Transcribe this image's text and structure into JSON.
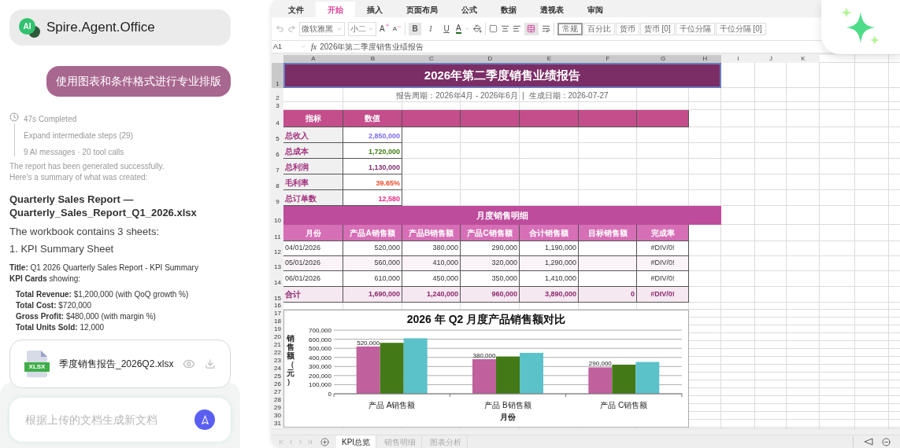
{
  "app": {
    "logo": "AI",
    "title": "Spire.Agent.Office"
  },
  "user_message": "使用图表和条件格式进行专业排版",
  "run": {
    "status": "47s Completed",
    "expand": "Expand intermediate steps (29)",
    "stats": "9 AI messages · 20 tool calls"
  },
  "response": {
    "intro": [
      "The report has been generated successfully.",
      "Here's a summary of what was created:"
    ],
    "heading": "Quarterly Sales Report — Quarterly_Sales_Report_Q1_2026.xlsx",
    "blocks": [
      {
        "kind": "lead",
        "text": "The workbook contains 3 sheets:"
      },
      {
        "kind": "lead",
        "text": "1. KPI Summary Sheet"
      },
      {
        "kind": "detail",
        "text": "**Title:** Q1 2026 Quarterly Sales Report - KPI Summary"
      },
      {
        "kind": "detail",
        "text": "**KPI Cards** showing:"
      },
      {
        "kind": "bullet",
        "text": "**Total Revenue:** $1,200,000 (with QoQ growth %)"
      },
      {
        "kind": "bullet",
        "text": "**Total Cost:** $720,000"
      },
      {
        "kind": "bullet",
        "text": "**Gross Profit:** $480,000 (with margin %)"
      },
      {
        "kind": "bullet",
        "text": "**Total Units Sold:** 12,000"
      }
    ]
  },
  "attachment": {
    "type": "XLSX",
    "name": "季度销售报告_2026Q2.xlsx"
  },
  "composer": {
    "placeholder": "根据上传的文档生成新文档"
  },
  "spreadsheet": {
    "ribbon_tabs": [
      {
        "label": "文件",
        "selected": false
      },
      {
        "label": "开始",
        "selected": true
      },
      {
        "label": "插入",
        "selected": false
      },
      {
        "label": "页面布局",
        "selected": false
      },
      {
        "label": "公式",
        "selected": false
      },
      {
        "label": "数据",
        "selected": false
      },
      {
        "label": "透视表",
        "selected": false
      },
      {
        "label": "审阅",
        "selected": false
      }
    ],
    "toolbar": {
      "font": "微软雅黑",
      "size": "小二",
      "size_buttons": [
        {
          "label": "A",
          "kind": "grow"
        },
        {
          "label": "A",
          "kind": "shrink"
        }
      ],
      "format_buttons": [
        {
          "label": "B",
          "kind": "bold",
          "selected": true
        },
        {
          "label": "I",
          "kind": "italic",
          "selected": false
        },
        {
          "label": "U",
          "kind": "underline",
          "selected": false
        }
      ],
      "font_color": {
        "label": "A",
        "color": "#1e6b1e"
      },
      "merge_selected": true,
      "cell_styles": [
        {
          "label": "常规",
          "selected": true,
          "color": "#ffffff"
        },
        {
          "label": "百分比",
          "selected": false,
          "color": "#ffffff"
        },
        {
          "label": "货币",
          "selected": false,
          "color": "#ffffff"
        },
        {
          "label": "货币 [0]",
          "selected": false,
          "color": "#ffffff"
        },
        {
          "label": "千位分隔",
          "selected": false,
          "color": "#ffffff"
        },
        {
          "label": "千位分隔 [0]",
          "selected": false,
          "color": "#ffffff"
        }
      ]
    },
    "formula_bar": {
      "cell": "A1",
      "fx": "fx",
      "formula": "2026年第二季度销售业绩报告"
    },
    "columns": [
      {
        "label": "A",
        "selected": true
      },
      {
        "label": "B",
        "selected": true
      },
      {
        "label": "C",
        "selected": true
      },
      {
        "label": "D",
        "selected": true
      },
      {
        "label": "E",
        "selected": true
      },
      {
        "label": "F",
        "selected": true
      },
      {
        "label": "G",
        "selected": true
      },
      {
        "label": "H",
        "selected": true
      },
      {
        "label": "I",
        "selected": false
      },
      {
        "label": "J",
        "selected": false
      },
      {
        "label": "K",
        "selected": false
      }
    ],
    "rows": [
      {
        "label": "1",
        "selected": true
      },
      {
        "label": "2",
        "selected": false
      },
      {
        "label": "3",
        "selected": false
      },
      {
        "label": "4",
        "selected": false
      },
      {
        "label": "5",
        "selected": false
      },
      {
        "label": "6",
        "selected": false
      },
      {
        "label": "7",
        "selected": false
      },
      {
        "label": "8",
        "selected": false
      },
      {
        "label": "9",
        "selected": false
      },
      {
        "label": "10",
        "selected": false
      },
      {
        "label": "11",
        "selected": false
      },
      {
        "label": "12",
        "selected": false
      },
      {
        "label": "13",
        "selected": false
      },
      {
        "label": "14",
        "selected": false
      },
      {
        "label": "15",
        "selected": false
      },
      {
        "label": "16",
        "selected": false
      },
      {
        "label": "17",
        "selected": false
      },
      {
        "label": "18",
        "selected": false
      },
      {
        "label": "19",
        "selected": false
      },
      {
        "label": "20",
        "selected": false
      },
      {
        "label": "21",
        "selected": false
      },
      {
        "label": "22",
        "selected": false
      },
      {
        "label": "23",
        "selected": false
      },
      {
        "label": "24",
        "selected": false
      },
      {
        "label": "25",
        "selected": false
      },
      {
        "label": "26",
        "selected": false
      },
      {
        "label": "27",
        "selected": false
      },
      {
        "label": "28",
        "selected": false
      },
      {
        "label": "29",
        "selected": false
      },
      {
        "label": "30",
        "selected": false
      },
      {
        "label": "31",
        "selected": false
      }
    ],
    "title": "2026年第二季度销售业绩报告",
    "subtitle": "报告周期：2026年4月 - 2026年6月  |  生成日期：2026-07-27",
    "kpi": {
      "columns": [
        "指标",
        "数值"
      ],
      "rows": [
        {
          "label": "总收入",
          "value": "2,850,000",
          "color": "#7a6cf0"
        },
        {
          "label": "总成本",
          "value": "1,720,000",
          "color": "#3a7d0c"
        },
        {
          "label": "总利润",
          "value": "1,130,000",
          "color": "#7b2d6e"
        },
        {
          "label": "毛利率",
          "value": "39.65%",
          "color": "#ee4a2a"
        },
        {
          "label": "总订单数",
          "value": "12,580",
          "color": "#ec2a86"
        }
      ]
    },
    "monthly": {
      "title": "月度销售明细",
      "columns": [
        "月份",
        "产品A销售额",
        "产品B销售额",
        "产品C销售额",
        "合计销售额",
        "目标销售额",
        "完成率"
      ],
      "rows": [
        {
          "month": "04/01/2026",
          "a": "520,000",
          "b": "380,000",
          "c": "290,000",
          "total": "1,190,000",
          "rate": "#DIV/0!"
        },
        {
          "month": "05/01/2026",
          "a": "560,000",
          "b": "410,000",
          "c": "320,000",
          "total": "1,290,000",
          "rate": "#DIV/0!"
        },
        {
          "month": "06/01/2026",
          "a": "610,000",
          "b": "450,000",
          "c": "350,000",
          "total": "1,410,000",
          "rate": "#DIV/0!"
        }
      ],
      "total": {
        "month": "合计",
        "a": "1,690,000",
        "b": "1,240,000",
        "c": "960,000",
        "total": "3,890,000",
        "target": "0",
        "rate": "#DIV/0!"
      }
    },
    "chart_data": {
      "type": "bar",
      "title": "2026 年 Q2 月度产品销售额对比",
      "xlabel": "月份",
      "ylabel": "销售额（元）",
      "categories": [
        "产品 A销售额",
        "产品 B销售额",
        "产品 C销售额"
      ],
      "series": [
        {
          "color": "#c0609c",
          "values": [
            520000,
            380000,
            290000
          ],
          "value_labels": [
            "520,000",
            "380,000",
            "290,000"
          ]
        },
        {
          "color": "#437a17",
          "values": [
            560000,
            410000,
            320000
          ]
        },
        {
          "color": "#5bc2c9",
          "values": [
            610000,
            450000,
            350000
          ]
        }
      ],
      "grid": true,
      "ylim": [
        0,
        700000
      ],
      "yticks": [
        {
          "value": 0,
          "label": "0"
        },
        {
          "value": 100000,
          "label": "100,000"
        },
        {
          "value": 200000,
          "label": "200,000"
        },
        {
          "value": 300000,
          "label": "300,000"
        },
        {
          "value": 400000,
          "label": "400,000"
        },
        {
          "value": 500000,
          "label": "500,000"
        },
        {
          "value": 600000,
          "label": "600,000"
        },
        {
          "value": 700000,
          "label": "700,000"
        }
      ]
    },
    "sheet_tabs": [
      {
        "label": "KPI总览",
        "selected": true
      },
      {
        "label": "销售明细",
        "selected": false
      },
      {
        "label": "图表分析",
        "selected": false
      }
    ]
  }
}
